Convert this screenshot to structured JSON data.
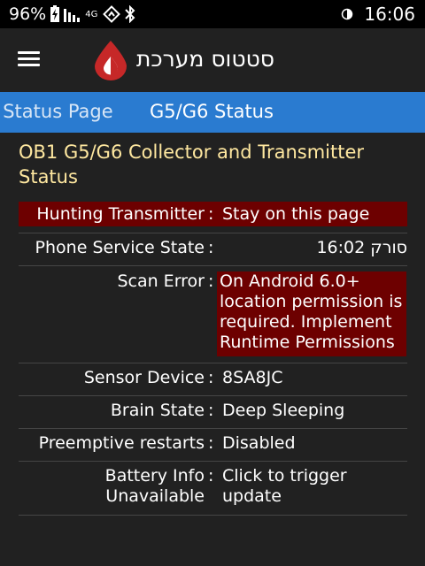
{
  "status_bar": {
    "battery": "96%",
    "network_label": "4G",
    "time": "16:06"
  },
  "app_bar": {
    "title": "סטטוס מערכת"
  },
  "tabs": [
    {
      "label": "c Status Page"
    },
    {
      "label": "G5/G6 Status"
    }
  ],
  "heading": "OB1 G5/G6 Collector and Transmitter Status",
  "rows": [
    {
      "label": "Hunting Transmitter",
      "colon": ":",
      "value": "Stay on this page"
    },
    {
      "label": "Phone Service State",
      "colon": ":",
      "value": "סורק 16:02"
    },
    {
      "label": "Scan Error",
      "colon": ":",
      "value": "On Android 6.0+ location permission is required. Implement Runtime Permissions"
    },
    {
      "label": "Sensor Device",
      "colon": ":",
      "value": "8SA8JC"
    },
    {
      "label": "Brain State",
      "colon": ":",
      "value": "Deep Sleeping"
    },
    {
      "label": "Preemptive restarts",
      "colon": ":",
      "value": "Disabled"
    },
    {
      "label": "Battery Info Unavailable",
      "colon": ":",
      "value": "Click to trigger update"
    }
  ],
  "colors": {
    "accent": "#2a7bd0",
    "alert_row": "#6d0000",
    "heading": "#ffe8a0",
    "background": "#212121"
  },
  "icons": [
    "battery-charging-icon",
    "signal-icon",
    "sync-icon",
    "bluetooth-icon",
    "data-saver-icon",
    "menu-icon",
    "blood-drop-logo"
  ]
}
